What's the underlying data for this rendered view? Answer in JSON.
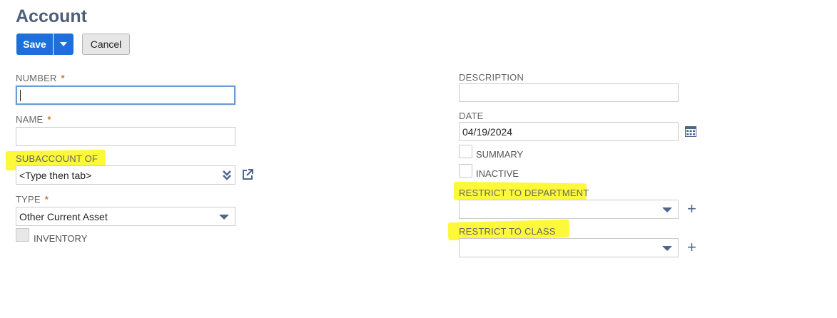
{
  "page": {
    "title": "Account"
  },
  "toolbar": {
    "save_label": "Save",
    "cancel_label": "Cancel"
  },
  "left": {
    "number_label": "NUMBER",
    "name_label": "NAME",
    "required_mark": "*",
    "subaccount_label": "SUBACCOUNT OF",
    "subaccount_placeholder": "<Type then tab>",
    "type_label": "TYPE",
    "type_value": "Other Current Asset",
    "inventory_label": "INVENTORY"
  },
  "right": {
    "description_label": "DESCRIPTION",
    "date_label": "DATE",
    "date_value": "04/19/2024",
    "summary_label": "SUMMARY",
    "inactive_label": "INACTIVE",
    "restrict_department_label": "RESTRICT TO DEPARTMENT",
    "restrict_class_label": "RESTRICT TO CLASS",
    "plus_symbol": "+"
  },
  "colors": {
    "primary_button": "#1e6fd9",
    "highlight": "#fdf83a",
    "title": "#4d5f79",
    "required": "#c77b2e"
  },
  "icons": {
    "subaccount_list": "double-chevron-down-icon",
    "subaccount_open": "open-external-icon",
    "calendar": "calendar-icon",
    "add": "plus-icon"
  }
}
